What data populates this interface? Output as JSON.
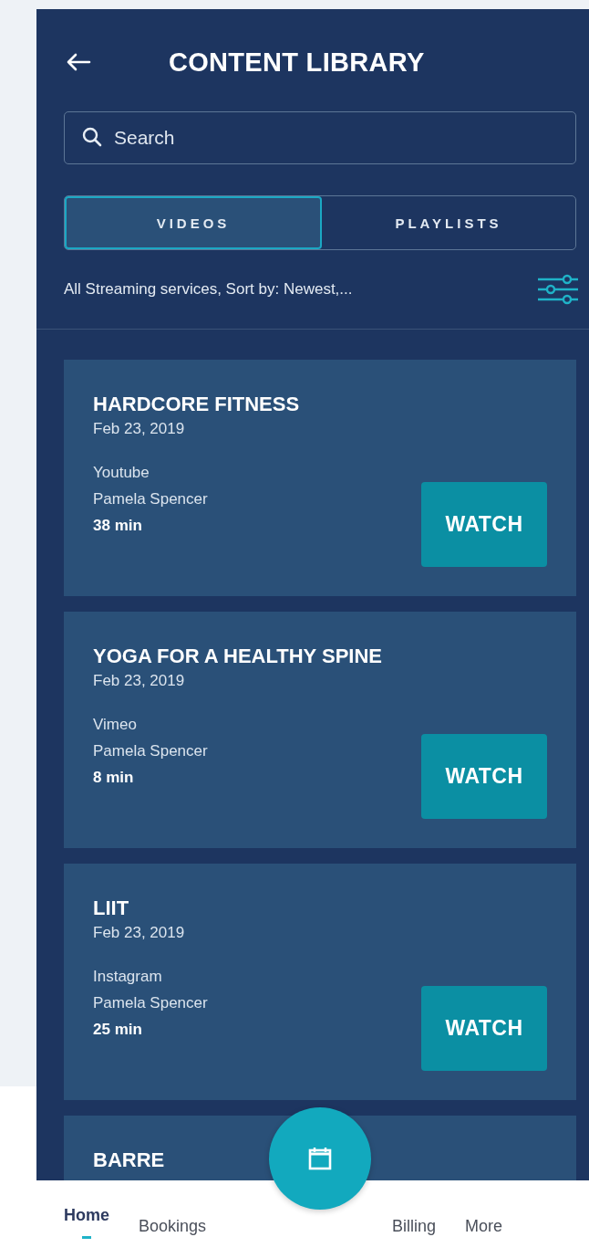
{
  "header": {
    "title": "CONTENT LIBRARY"
  },
  "search": {
    "placeholder": "Search"
  },
  "tabs": [
    {
      "label": "VIDEOS",
      "selected": true
    },
    {
      "label": "PLAYLISTS",
      "selected": false
    }
  ],
  "filter_summary": "All Streaming services, Sort by: Newest,...",
  "videos": [
    {
      "title": "HARDCORE FITNESS",
      "date": "Feb 23, 2019",
      "service": "Youtube",
      "instructor": "Pamela Spencer",
      "duration": "38 min",
      "action": "WATCH"
    },
    {
      "title": "YOGA FOR A HEALTHY SPINE",
      "date": "Feb 23, 2019",
      "service": "Vimeo",
      "instructor": "Pamela Spencer",
      "duration": "8 min",
      "action": "WATCH"
    },
    {
      "title": "LIIT",
      "date": "Feb 23, 2019",
      "service": "Instagram",
      "instructor": "Pamela Spencer",
      "duration": "25 min",
      "action": "WATCH"
    },
    {
      "title": "BARRE"
    }
  ],
  "bottom_nav": [
    {
      "label": "Home",
      "selected": true
    },
    {
      "label": "Bookings",
      "selected": false
    },
    {
      "label": "Billing",
      "selected": false
    },
    {
      "label": "More",
      "selected": false
    }
  ]
}
